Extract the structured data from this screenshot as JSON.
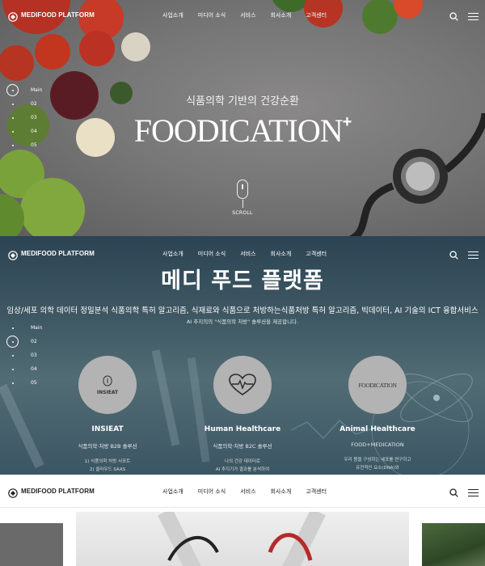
{
  "brand": {
    "name": "MEDIFOOD PLATFORM"
  },
  "nav": {
    "items": [
      "사업소개",
      "미디어 소식",
      "서비스",
      "회사소개",
      "고객센터"
    ]
  },
  "icons": {
    "search": "search-icon",
    "menu": "hamburger-menu-icon",
    "logo": "medifood-logo-icon"
  },
  "pager": {
    "items": [
      "Main",
      "02",
      "03",
      "04",
      "05"
    ]
  },
  "hero": {
    "subtitle": "식품의학 기반의 건강순환",
    "brand_text": "FOODICATION",
    "brand_plus": "+",
    "scroll_label": "SCROLL"
  },
  "platform": {
    "title": "메디 푸드 플랫폼",
    "lead": "임상/세포 의학 데이터 정밀분석 식품의학 특허 알고리즘, 식재료와 식품으로 처방하는식품처방 특허 알고리즘, 빅데이터, AI 기술의 ICT 융합서비스",
    "sub": "AI 추지의의 \"식품의학 처방\" 솔루션을 제공합니다.",
    "cards": [
      {
        "logo": "INSIEAT",
        "title": "INSIEAT",
        "desc": "식품의학·처방 B2B 솔루션",
        "detail": [
          "1) 식품의학 처방 서포트",
          "2) 클라우드 SAAS"
        ]
      },
      {
        "logo": "",
        "title": "Human Healthcare",
        "desc": "식품의학·처방 B2C 솔루션",
        "detail": [
          "나의 건강 데이터로",
          "AI 추지기가 결과를 분석하여"
        ]
      },
      {
        "logo": "FOODICATION",
        "title": "Animal Healthcare",
        "desc": "FOOD+MEDICATION",
        "detail": [
          "우리 몸을 구성하는 세포를 연구하고",
          "유전적인 요소(DNA)와"
        ]
      }
    ]
  },
  "colors": {
    "header_dark_text": "#222222",
    "section2_bg": "#3f5964",
    "circle_bg": "#b3b3b3"
  }
}
